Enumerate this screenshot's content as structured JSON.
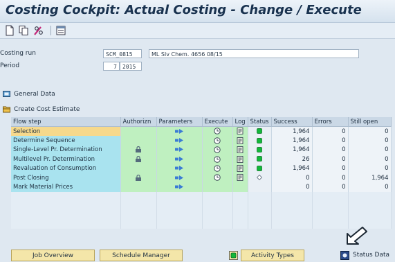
{
  "window": {
    "title": "Costing Cockpit: Actual Costing - Change / Execute"
  },
  "toolbar": {
    "icons": [
      "new-document-icon",
      "copy-icon",
      "edit-glasses-icon",
      "layout-icon"
    ]
  },
  "fields": {
    "costing_run": {
      "label": "Costing run",
      "code": "SCM_0815",
      "description": "ML Slv Chem. 4656 08/15"
    },
    "period": {
      "label": "Period",
      "month": "7",
      "year": "2015"
    }
  },
  "sections": {
    "general": "General Data",
    "create": "Create Cost Estimate"
  },
  "table": {
    "columns": [
      "Flow step",
      "Authorizn",
      "Parameters",
      "Execute",
      "Log",
      "Status",
      "Success",
      "Errors",
      "Still open"
    ],
    "rows": [
      {
        "step": "Selection",
        "auth": false,
        "status": "green",
        "success": "1,964",
        "errors": "0",
        "open": "0"
      },
      {
        "step": "Determine Sequence",
        "auth": false,
        "status": "green",
        "success": "1,964",
        "errors": "0",
        "open": "0"
      },
      {
        "step": "Single-Level Pr. Determination",
        "auth": true,
        "status": "green",
        "success": "1,964",
        "errors": "0",
        "open": "0"
      },
      {
        "step": "Multilevel Pr. Determination",
        "auth": true,
        "status": "green",
        "success": "26",
        "errors": "0",
        "open": "0"
      },
      {
        "step": "Revaluation of Consumption",
        "auth": false,
        "status": "green",
        "success": "1,964",
        "errors": "0",
        "open": "0"
      },
      {
        "step": "Post Closing",
        "auth": true,
        "status": "diamond",
        "success": "0",
        "errors": "0",
        "open": "1,964"
      },
      {
        "step": "Mark Material Prices",
        "auth": false,
        "status": "none",
        "success": "0",
        "errors": "0",
        "open": "0"
      }
    ]
  },
  "buttons": {
    "job_overview": "Job Overview",
    "schedule_manager": "Schedule Manager",
    "activity_types": "Activity Types",
    "status_data": "Status Data"
  },
  "colors": {
    "flow_step": "#a9e3ef",
    "selected_step": "#f6d98c",
    "action_cells": "#bff0c0",
    "status_ok": "#12b83a",
    "button": "#f4e6a9"
  }
}
